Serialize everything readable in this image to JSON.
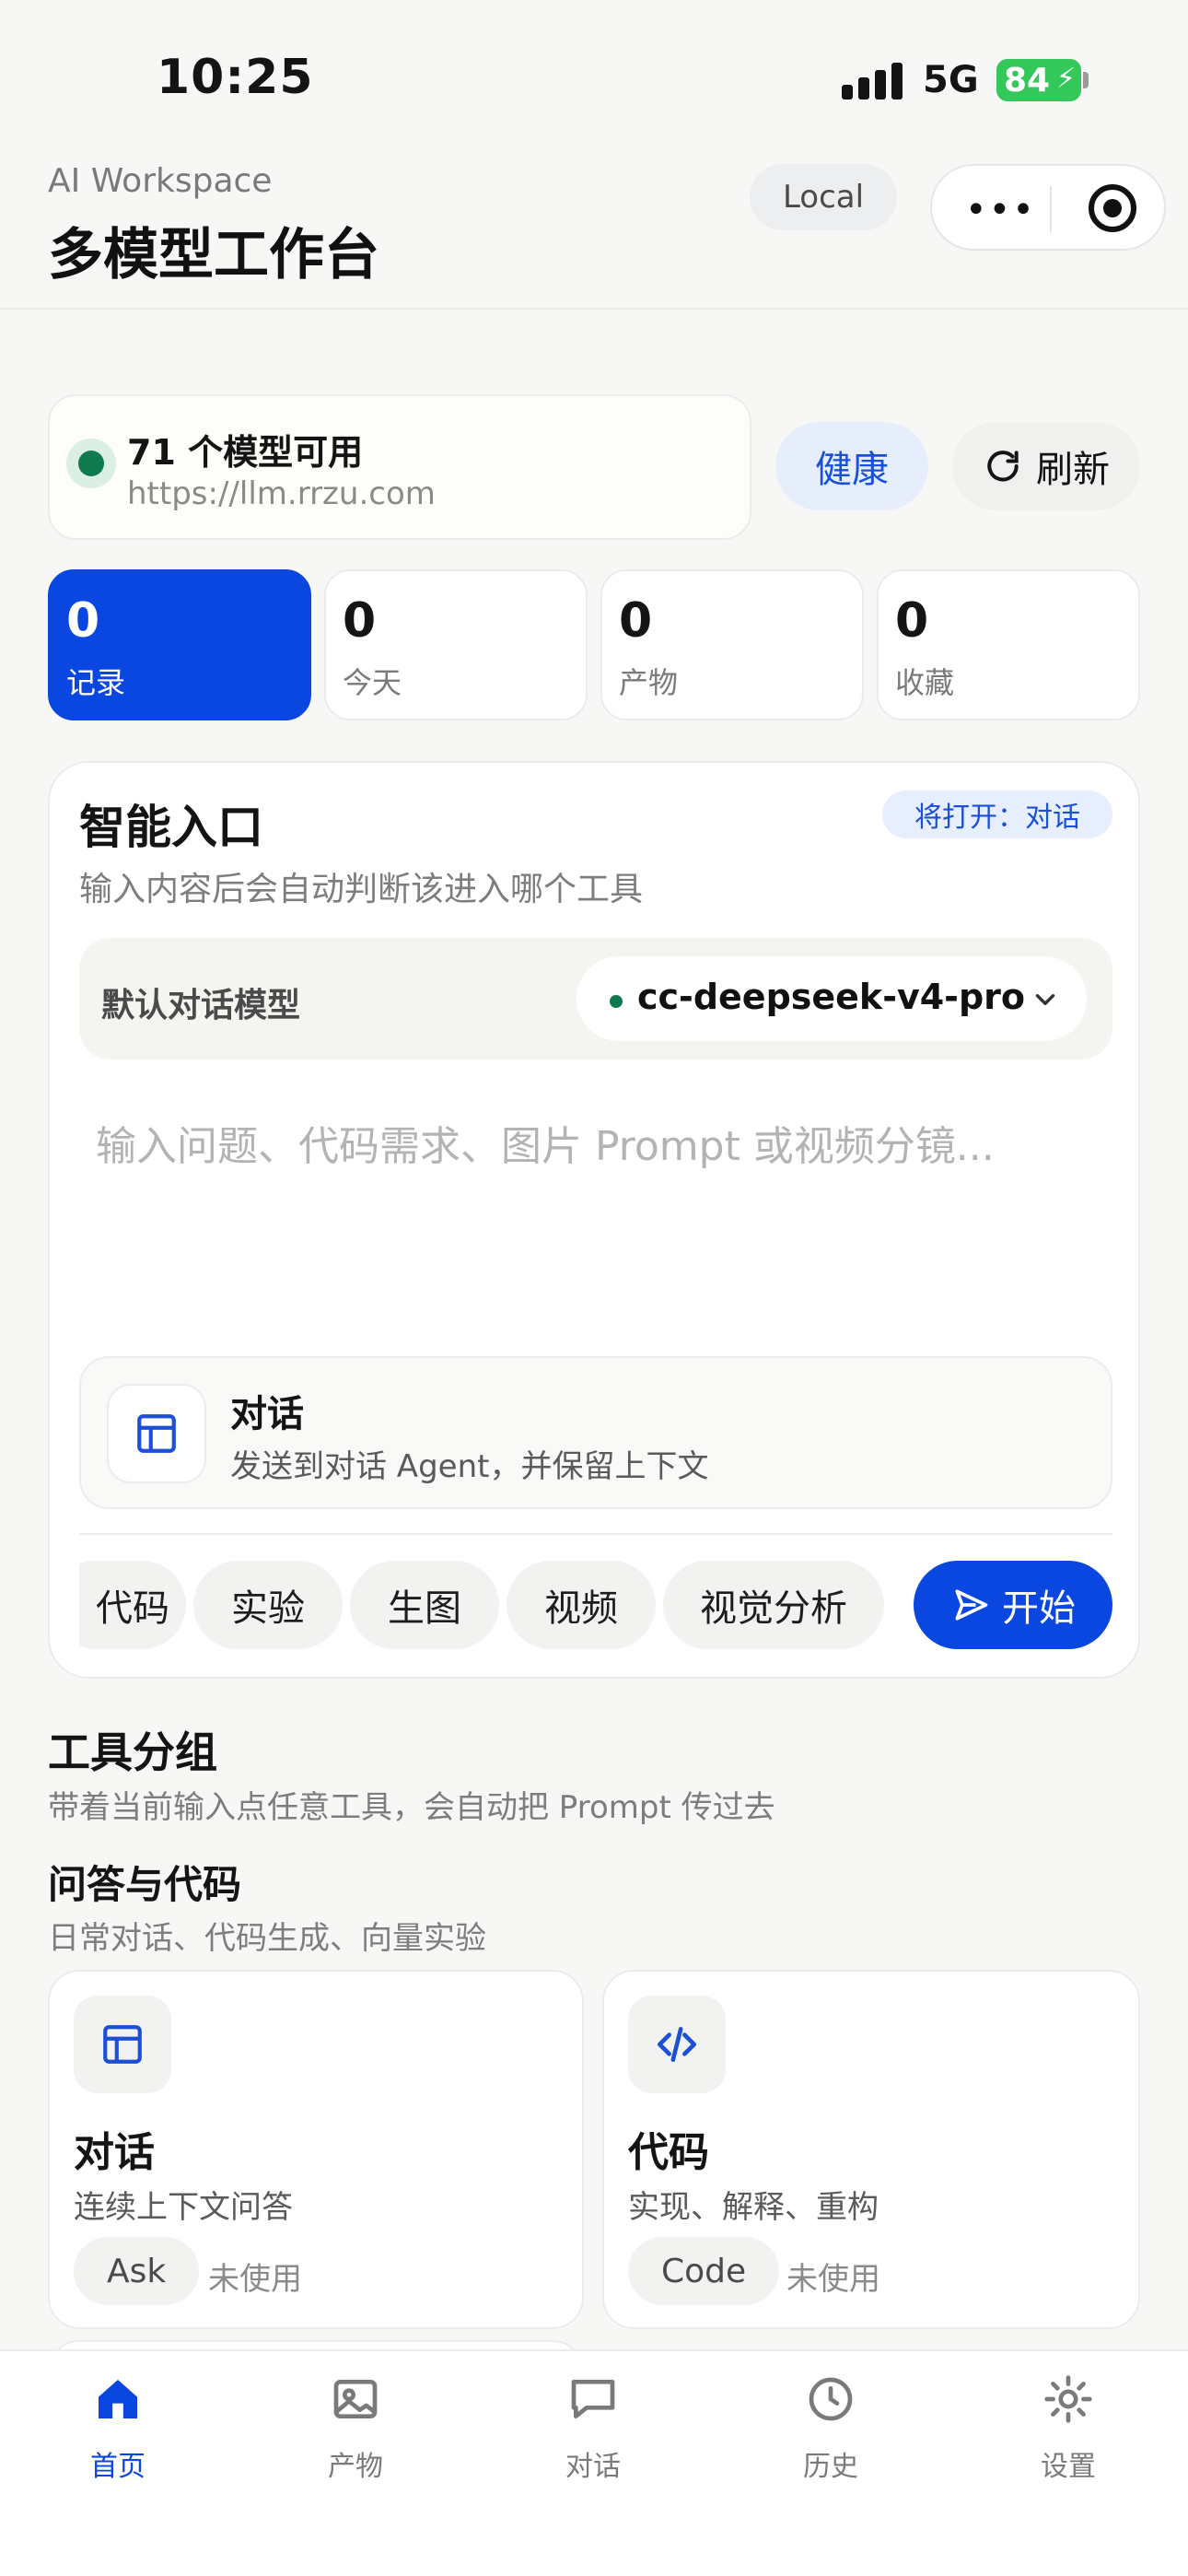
{
  "status_bar": {
    "time": "10:25",
    "network": "5G",
    "battery": "84"
  },
  "header": {
    "subtitle": "AI Workspace",
    "title": "多模型工作台",
    "env_badge": "Local"
  },
  "connection": {
    "title": "71 个模型可用",
    "url": "https://llm.rrzu.com",
    "health_label": "健康",
    "refresh_label": "刷新",
    "status_color": "#0f7a4d"
  },
  "stats": [
    {
      "value": "0",
      "label": "记录"
    },
    {
      "value": "0",
      "label": "今天"
    },
    {
      "value": "0",
      "label": "产物"
    },
    {
      "value": "0",
      "label": "收藏"
    }
  ],
  "smart_entry": {
    "title": "智能入口",
    "description": "输入内容后会自动判断该进入哪个工具",
    "target_badge": "将打开：对话",
    "model_label": "默认对话模型",
    "model_value": "cc-deepseek-v4-pro",
    "prompt_value": "",
    "prompt_placeholder": "输入问题、代码需求、图片 Prompt 或视频分镜...",
    "route": {
      "title": "对话",
      "description": "发送到对话 Agent，并保留上下文",
      "icon": "layout-icon"
    },
    "chips": [
      "代码",
      "实验",
      "生图",
      "视频",
      "视觉分析"
    ],
    "start_label": "开始"
  },
  "tool_groups": {
    "title": "工具分组",
    "description": "带着当前输入点任意工具，会自动把 Prompt 传过去",
    "groups": [
      {
        "title": "问答与代码",
        "description": "日常对话、代码生成、向量实验",
        "tools": [
          {
            "name": "对话",
            "description": "连续上下文问答",
            "tag": "Ask",
            "usage": "未使用",
            "icon": "layout-icon"
          },
          {
            "name": "代码",
            "description": "实现、解释、重构",
            "tag": "Code",
            "usage": "未使用",
            "icon": "code-icon"
          }
        ]
      }
    ]
  },
  "tabbar": [
    {
      "label": "首页",
      "icon": "home-icon",
      "active": true
    },
    {
      "label": "产物",
      "icon": "image-icon",
      "active": false
    },
    {
      "label": "对话",
      "icon": "chat-icon",
      "active": false
    },
    {
      "label": "历史",
      "icon": "clock-icon",
      "active": false
    },
    {
      "label": "设置",
      "icon": "gear-icon",
      "active": false
    }
  ],
  "colors": {
    "accent": "#0a47e0",
    "success": "#0f7a4d",
    "background": "#f7f7f5"
  }
}
